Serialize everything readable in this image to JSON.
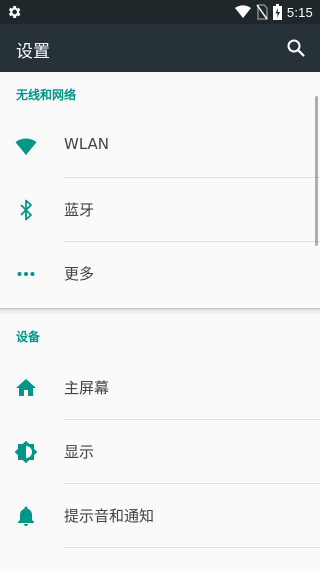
{
  "status_bar": {
    "time": "5:15"
  },
  "toolbar": {
    "title": "设置"
  },
  "sections": [
    {
      "category": "无线和网络",
      "items": [
        {
          "label": "WLAN",
          "icon": "wifi-icon"
        },
        {
          "label": "蓝牙",
          "icon": "bluetooth-icon"
        },
        {
          "label": "更多",
          "icon": "more-icon"
        }
      ]
    },
    {
      "category": "设备",
      "items": [
        {
          "label": "主屏幕",
          "icon": "home-icon"
        },
        {
          "label": "显示",
          "icon": "brightness-icon"
        },
        {
          "label": "提示音和通知",
          "icon": "bell-icon"
        }
      ]
    }
  ],
  "colors": {
    "accent": "#009688",
    "toolbar": "#263238",
    "status_bar": "#1e282b"
  }
}
